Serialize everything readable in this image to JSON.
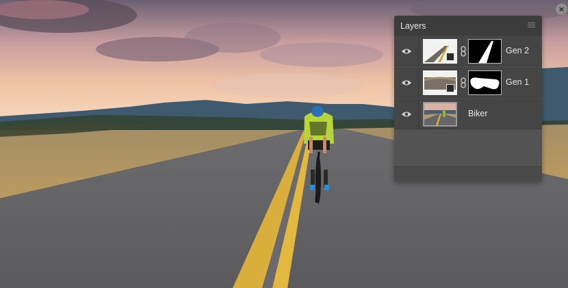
{
  "window": {
    "close_glyph": "×"
  },
  "layers_panel": {
    "title": "Layers",
    "menu_icon": "hamburger-menu-icon",
    "layers": [
      {
        "name": "Gen 2",
        "visible": true,
        "has_mask": true,
        "icon": "eye-icon"
      },
      {
        "name": "Gen 1",
        "visible": true,
        "has_mask": true,
        "icon": "eye-icon"
      },
      {
        "name": "Biker",
        "visible": true,
        "has_mask": false,
        "icon": "eye-icon"
      }
    ]
  },
  "colors": {
    "panel_bg": "#535353",
    "panel_header": "#3c3c3c",
    "row_bg": "#454545",
    "text": "#e6e6e6",
    "road_line": "#e0b53a",
    "jersey": "#b7d43a",
    "helmet": "#2b6fb8"
  }
}
